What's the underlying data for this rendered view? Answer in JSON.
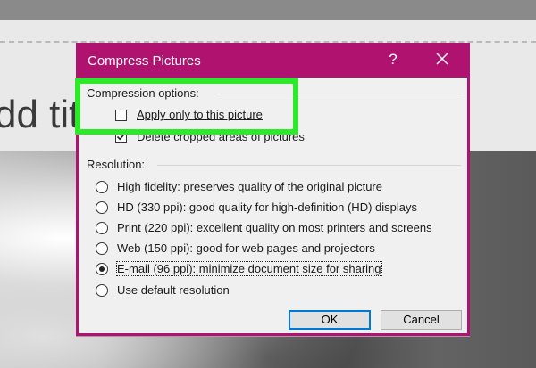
{
  "slide": {
    "title_fragment": "dd tit"
  },
  "dialog": {
    "title": "Compress Pictures",
    "help_label": "?",
    "compression_options": {
      "heading": "Compression options:",
      "apply_only": {
        "label": "Apply only to this picture",
        "checked": false
      },
      "delete_cropped": {
        "label": "Delete cropped areas of pictures",
        "checked": true
      }
    },
    "resolution": {
      "heading": "Resolution:",
      "options": [
        {
          "label": "High fidelity: preserves quality of the original picture",
          "selected": false
        },
        {
          "label": "HD (330 ppi): good quality for high-definition (HD) displays",
          "selected": false
        },
        {
          "label": "Print (220 ppi): excellent quality on most printers and screens",
          "selected": false
        },
        {
          "label": "Web (150 ppi): good for web pages and projectors",
          "selected": false
        },
        {
          "label": "E-mail (96 ppi): minimize document size for sharing",
          "selected": true
        },
        {
          "label": "Use default resolution",
          "selected": false
        }
      ]
    },
    "buttons": {
      "ok": "OK",
      "cancel": "Cancel"
    }
  },
  "colors": {
    "titlebar": "#b0136f",
    "highlight": "#2ee82a",
    "default_button_border": "#0078d7"
  }
}
